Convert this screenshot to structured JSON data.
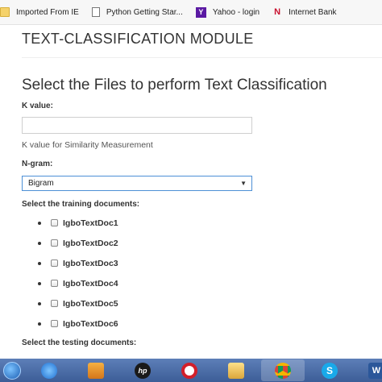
{
  "bookmarks": [
    {
      "label": "Imported From IE",
      "icon": "folder-icon"
    },
    {
      "label": "Python Getting Star...",
      "icon": "page-icon"
    },
    {
      "label": "Yahoo - login",
      "icon": "yahoo-icon",
      "icon_text": "Y"
    },
    {
      "label": "Internet Bank",
      "icon": "internet-bank-icon",
      "icon_text": "N"
    }
  ],
  "page": {
    "module_title": "TEXT-CLASSIFICATION MODULE",
    "section_title": "Select the Files to perform Text Classification",
    "k_value_label": "K value:",
    "k_value_input": "",
    "k_value_hint": "K value for Similarity Measurement",
    "ngram_label": "N-gram:",
    "ngram_selected": "Bigram",
    "training_label": "Select the training documents:",
    "training_docs": [
      "IgboTextDoc1",
      "IgboTextDoc2",
      "IgboTextDoc3",
      "IgboTextDoc4",
      "IgboTextDoc5",
      "IgboTextDoc6"
    ],
    "testing_label": "Select the testing documents:"
  },
  "taskbar": {
    "hp_text": "hp",
    "skype_text": "S",
    "word_text": "W",
    "items": [
      "start-orb",
      "internet-explorer-icon",
      "media-player-icon",
      "hp-icon",
      "opera-icon",
      "file-explorer-icon",
      "chrome-icon",
      "skype-icon",
      "word-icon"
    ]
  },
  "colors": {
    "select_border": "#4d90d6",
    "taskbar": "#4a6ca6"
  }
}
